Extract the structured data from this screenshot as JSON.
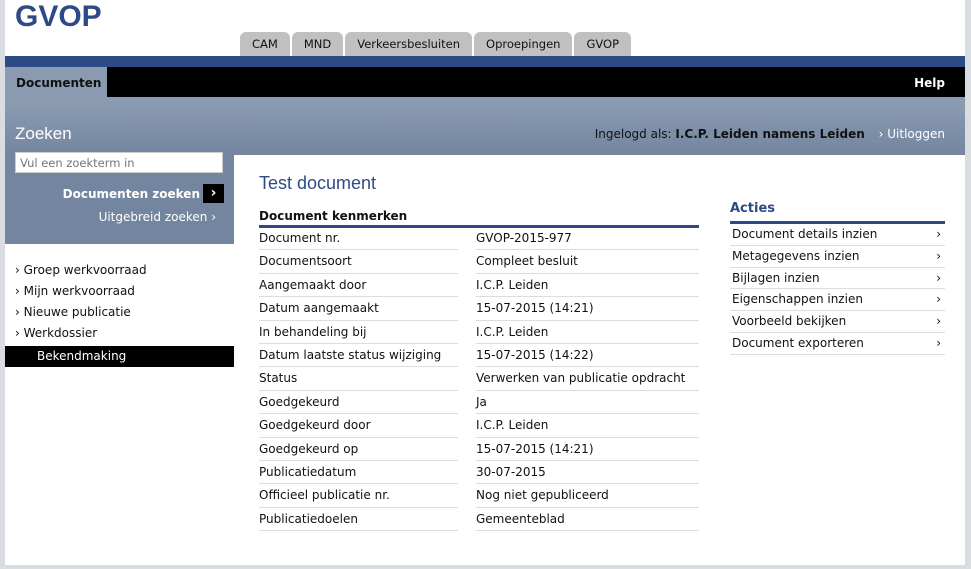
{
  "logo": "GVOP",
  "tabs": [
    "CAM",
    "MND",
    "Verkeersbesluiten",
    "Oproepingen",
    "GVOP"
  ],
  "nav_active": "Documenten",
  "help": "Help",
  "zoeken": "Zoeken",
  "login": {
    "label": "Ingelogd als:",
    "user": "I.C.P. Leiden namens Leiden",
    "logout": "Uitloggen"
  },
  "search": {
    "placeholder": "Vul een zoekterm in",
    "button": "Documenten zoeken",
    "advanced": "Uitgebreid zoeken"
  },
  "sidebar": [
    "Groep werkvoorraad",
    "Mijn werkvoorraad",
    "Nieuwe publicatie",
    "Werkdossier"
  ],
  "sidebar_active": "Bekendmaking",
  "title": "Test document",
  "kenmerken_header": "Document kenmerken",
  "rows": [
    {
      "l": "Document nr.",
      "v": "GVOP-2015-977"
    },
    {
      "l": "Documentsoort",
      "v": "Compleet besluit"
    },
    {
      "l": "Aangemaakt door",
      "v": "I.C.P. Leiden"
    },
    {
      "l": "Datum aangemaakt",
      "v": "15-07-2015 (14:21)"
    },
    {
      "l": "In behandeling bij",
      "v": "I.C.P. Leiden"
    },
    {
      "l": "Datum laatste status wijziging",
      "v": "15-07-2015 (14:22)"
    },
    {
      "l": "Status",
      "v": "Verwerken van publicatie opdracht"
    },
    {
      "l": "Goedgekeurd",
      "v": "Ja"
    },
    {
      "l": "Goedgekeurd door",
      "v": "I.C.P. Leiden"
    },
    {
      "l": "Goedgekeurd op",
      "v": "15-07-2015 (14:21)"
    },
    {
      "l": "Publicatiedatum",
      "v": "30-07-2015"
    },
    {
      "l": "Officieel publicatie nr.",
      "v": "Nog niet gepubliceerd"
    },
    {
      "l": "Publicatiedoelen",
      "v": "Gemeenteblad"
    }
  ],
  "acties": {
    "title": "Acties",
    "items": [
      "Document details inzien",
      "Metagegevens inzien",
      "Bijlagen inzien",
      "Eigenschappen inzien",
      "Voorbeeld bekijken",
      "Document exporteren"
    ]
  },
  "colors": {
    "brand": "#2e4a86",
    "panel": "#74869f"
  }
}
